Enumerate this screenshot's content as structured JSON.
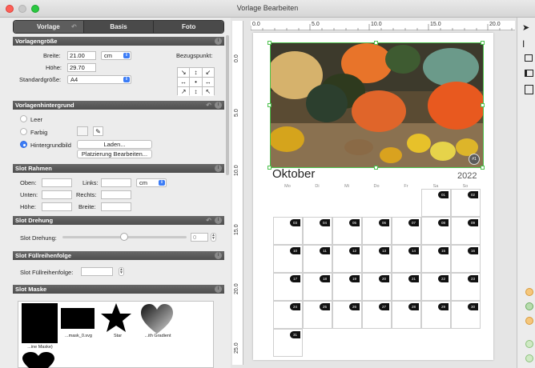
{
  "window": {
    "title": "Vorlage Bearbeiten"
  },
  "tabs": [
    {
      "label": "Vorlage"
    },
    {
      "label": "Basis"
    },
    {
      "label": "Foto"
    }
  ],
  "sections": {
    "size": "Vorlagengröße",
    "background": "Vorlagenhintergrund",
    "frame": "Slot Rahmen",
    "rotation": "Slot Drehung",
    "fillorder": "Slot Füllreihenfolge",
    "mask": "Slot Maske"
  },
  "size": {
    "width_label": "Breite:",
    "width_value": "21.00",
    "unit": "cm",
    "height_label": "Höhe:",
    "height_value": "29.70",
    "standard_label": "Standardgröße:",
    "standard_value": "A4",
    "ref_label": "Bezugspunkt:",
    "ref_grid": [
      "↘",
      "↕",
      "↙",
      "↔",
      "•",
      "↔",
      "↗",
      "↕",
      "↖"
    ]
  },
  "background": {
    "empty": "Leer",
    "colored": "Farbig",
    "image": "Hintergrundbild",
    "load_button": "Laden...",
    "placement_button": "Platzierung Bearbeiten..."
  },
  "frame": {
    "top": "Oben:",
    "left": "Links:",
    "unit": "cm",
    "bottom": "Unten:",
    "right": "Rechts:",
    "height": "Höhe:",
    "width": "Breite:"
  },
  "rotation": {
    "label": "Slot Drehung:",
    "value": "0"
  },
  "fillorder": {
    "label": "Slot Füllreihenfolge:"
  },
  "masks": [
    {
      "label": "...ine Maske)"
    },
    {
      "label": "...mask_0.svg"
    },
    {
      "label": "Star"
    },
    {
      "label": "...ith Gradient"
    }
  ],
  "ruler": {
    "h_ticks": [
      "0.0",
      "5.0",
      "10.0",
      "15.0",
      "20.0"
    ],
    "v_ticks": [
      "0.0",
      "5.0",
      "10.0",
      "15.0",
      "20.0",
      "25.0"
    ]
  },
  "calendar": {
    "month": "Oktober",
    "year": "2022",
    "slot_badge": "#1",
    "weekdays": [
      "Mo",
      "Di",
      "Mi",
      "Do",
      "Fr",
      "Sa",
      "So"
    ],
    "days": [
      "01",
      "02",
      "03",
      "04",
      "05",
      "06",
      "07",
      "08",
      "09",
      "10",
      "11",
      "12",
      "13",
      "14",
      "15",
      "16",
      "17",
      "18",
      "19",
      "20",
      "21",
      "22",
      "23",
      "24",
      "25",
      "26",
      "27",
      "28",
      "29",
      "30",
      "31"
    ]
  },
  "colors": {
    "accent": "#3b7cf6",
    "selection": "#4cc24c",
    "header": "#565656"
  }
}
